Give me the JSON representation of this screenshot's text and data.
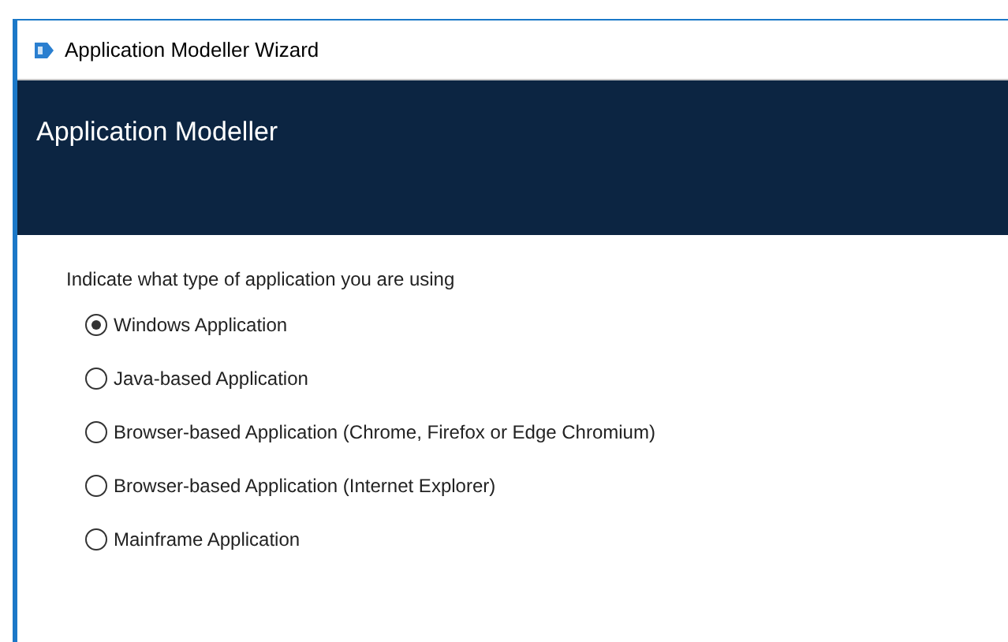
{
  "window": {
    "title": "Application Modeller Wizard"
  },
  "header": {
    "title": "Application Modeller"
  },
  "prompt": "Indicate what type of application you are using",
  "options": [
    {
      "label": "Windows Application",
      "selected": true
    },
    {
      "label": "Java-based Application",
      "selected": false
    },
    {
      "label": "Browser-based Application (Chrome, Firefox or Edge Chromium)",
      "selected": false
    },
    {
      "label": "Browser-based Application (Internet Explorer)",
      "selected": false
    },
    {
      "label": "Mainframe Application",
      "selected": false
    }
  ]
}
